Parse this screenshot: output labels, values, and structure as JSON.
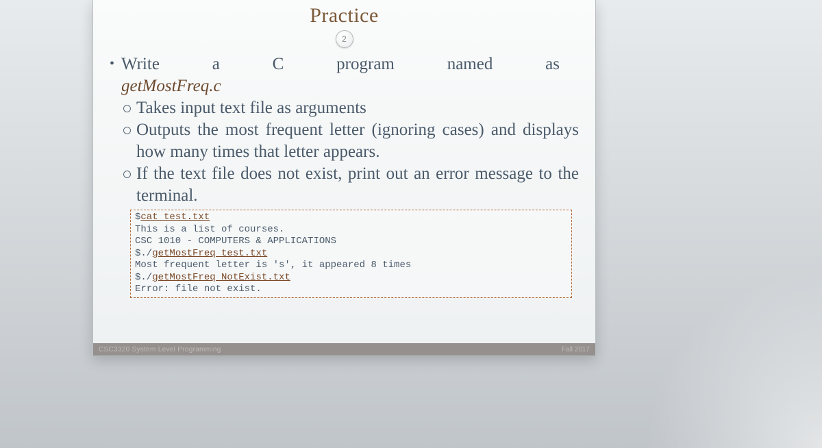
{
  "slide": {
    "title": "Practice",
    "pager": "2",
    "line1_words": [
      "Write",
      "a",
      "C",
      "program",
      "named",
      "as"
    ],
    "filename": "getMostFreq.c",
    "sub": [
      "Takes input text file as arguments",
      "Outputs the most frequent letter (ignoring cases) and displays how many times that letter appears.",
      "If the text file does not exist, print out an error message to the terminal."
    ],
    "terminal": {
      "l1a": "$",
      "l1b": "cat test.txt",
      "l2": "This is a list of courses.",
      "l3": "CSC 1010 - COMPUTERS & APPLICATIONS",
      "l4a": "$./",
      "l4b": "getMostFreq test.txt",
      "l5": "Most frequent letter is 's', it appeared 8 times",
      "l6a": "$./",
      "l6b": "getMostFreq NotExist.txt",
      "l7": "Error: file not exist."
    },
    "footer_left": "CSC3320 System Level Programming",
    "footer_right": "Fall 2017"
  }
}
